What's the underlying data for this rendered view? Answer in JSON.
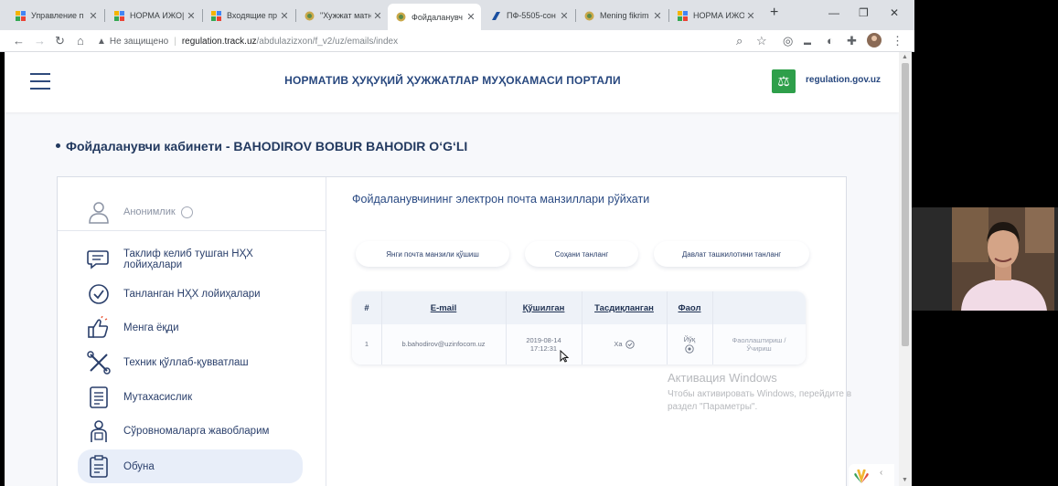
{
  "browser": {
    "tabs": [
      {
        "title": "Управление п",
        "icon": "grid-favicon"
      },
      {
        "title": "НОРМА ИЖО|",
        "icon": "grid-favicon"
      },
      {
        "title": "Входящие пр",
        "icon": "grid-favicon"
      },
      {
        "title": "\"Хужжат матн",
        "icon": "emblem-favicon"
      },
      {
        "title": "Фойдаланувч",
        "icon": "emblem-favicon",
        "active": true
      },
      {
        "title": "ПФ-5505-сон",
        "icon": "lex-favicon"
      },
      {
        "title": "Mening fikrim",
        "icon": "emblem-favicon"
      },
      {
        "title": "НОРМА ИЖО|",
        "icon": "grid-favicon"
      }
    ],
    "new_tab": "+",
    "address": {
      "security_label": "Не защищено",
      "host": "regulation.track.uz",
      "path": "/abdulazizxon/f_v2/uz/emails/index"
    }
  },
  "header": {
    "portal_title": "НОРМАТИВ ҲУҚУҚИЙ ҲУЖЖАТЛАР МУҲОКАМАСИ ПОРТАЛИ",
    "site_name": "regulation.gov.uz"
  },
  "cabinet_title": "Фойдаланувчи кабинети - BAHODIROV BOBUR BAHODIR O‘G‘LI",
  "sidebar": {
    "anon_label": "Анонимлик",
    "items": [
      {
        "label": "Таклиф келиб тушган НҲХ лойиҳалари",
        "icon": "chat-document-icon"
      },
      {
        "label": "Танланган НҲХ лойиҳалари",
        "icon": "check-circle-icon"
      },
      {
        "label": "Менга ёқди",
        "icon": "thumbs-up-icon"
      },
      {
        "label": "Техник қўллаб-қувватлаш",
        "icon": "tools-icon"
      },
      {
        "label": "Мутахасислик",
        "icon": "document-list-icon"
      },
      {
        "label": "Сўровномаларга жавобларим",
        "icon": "person-survey-icon"
      },
      {
        "label": "Обуна",
        "icon": "subscription-document-icon",
        "active": true
      }
    ]
  },
  "content": {
    "title": "Фойдаланувчининг электрон почта манзиллари рўйхати",
    "buttons": [
      "Янги почта манзили қўшиш",
      "Соҳани танланг",
      "Давлат ташкилотини танланг"
    ],
    "table": {
      "headers": [
        "#",
        "E-mail",
        "Қўшилган",
        "Тасдиқланган",
        "Фаол",
        ""
      ],
      "rows": [
        {
          "num": "1",
          "email": "b.bahodirov@uzinfocom.uz",
          "added_date": "2019-08-14",
          "added_time": "17:12:31",
          "confirmed": "Ха",
          "active": "Йўқ",
          "action_activate": "Фаоллаштириш /",
          "action_delete": "Ўчириш"
        }
      ]
    }
  },
  "windows_activation": {
    "line1": "Активация Windows",
    "line2": "Чтобы активировать Windows, перейдите в раздел \"Параметры\"."
  },
  "colors": {
    "brand_navy": "#27477e",
    "gov_green": "#2e9f4a",
    "page_bg": "#f7f8fb"
  }
}
